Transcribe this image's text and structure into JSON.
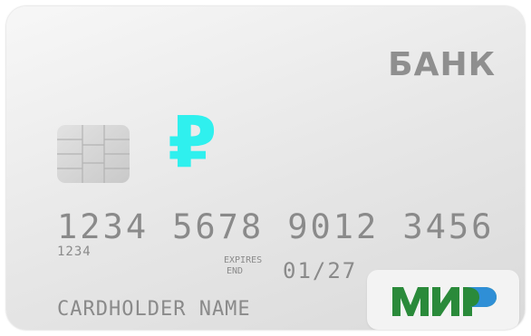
{
  "card": {
    "bank_name": "БАНК",
    "currency_symbol": "₽",
    "card_number": [
      "1234",
      "5678",
      "9012",
      "3456"
    ],
    "small_number": "1234",
    "expires_label_line1": "EXPIRES",
    "expires_label_line2": "END",
    "expiry_date": "01/27",
    "cardholder_name": "CARDHOLDER NAME",
    "payment_system_logo": "МИР"
  },
  "colors": {
    "card_background": "#e9e9e9",
    "bank_text": "#8f8f8f",
    "ruble_accent": "#2ff0ee",
    "mir_green": "#2a8a3a",
    "mir_blue": "#2f8fd6",
    "embossed_text": "#8a8a8a"
  },
  "icons": {
    "chip": "emv-chip-icon",
    "currency": "ruble-icon",
    "logo": "mir-logo-icon"
  }
}
